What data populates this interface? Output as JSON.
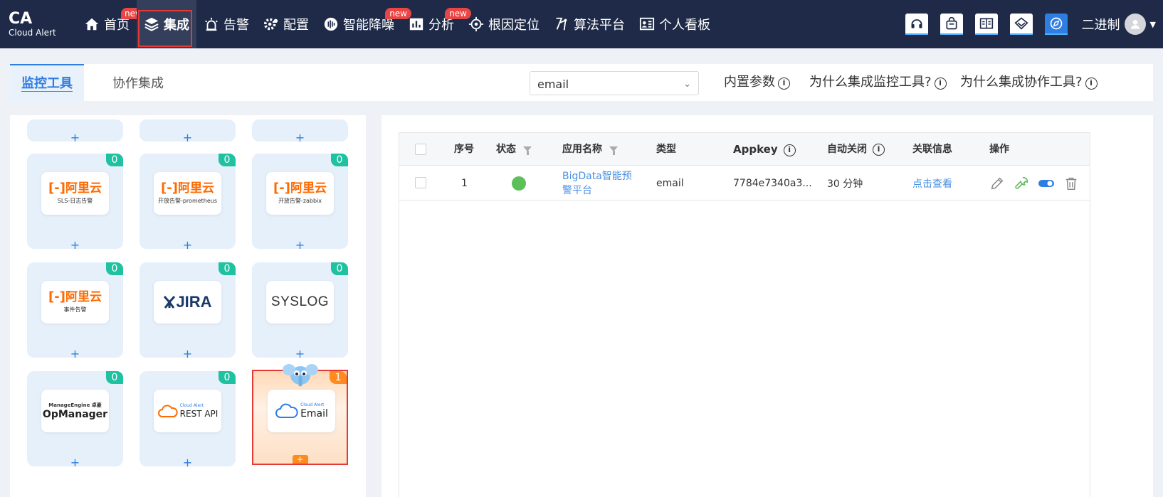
{
  "brand": {
    "name": "CA",
    "subtitle": "Cloud Alert"
  },
  "nav": {
    "items": [
      {
        "label": "首页",
        "icon": "home-icon",
        "badge": "new",
        "badge_style": "clipped"
      },
      {
        "label": "集成",
        "icon": "layers-icon",
        "active": true
      },
      {
        "label": "告警",
        "icon": "alarm-icon"
      },
      {
        "label": "配置",
        "icon": "gear-icon"
      },
      {
        "label": "智能降噪",
        "icon": "noise-reduction-icon",
        "badge": "new"
      },
      {
        "label": "分析",
        "icon": "bar-chart-icon",
        "badge": "new"
      },
      {
        "label": "根因定位",
        "icon": "target-icon"
      },
      {
        "label": "算法平台",
        "icon": "algorithm-icon"
      },
      {
        "label": "个人看板",
        "icon": "dashboard-icon"
      }
    ]
  },
  "toolbar_icons": [
    "headset-icon",
    "bag-icon",
    "book-icon",
    "diamond-icon",
    "compass-icon"
  ],
  "user": {
    "name": "二进制"
  },
  "tabs": [
    {
      "label": "监控工具",
      "active": true
    },
    {
      "label": "协作集成",
      "active": false
    }
  ],
  "search": {
    "value": "email"
  },
  "help_links": {
    "builtin_params": "内置参数",
    "why_monitor": "为什么集成监控工具?",
    "why_collab": "为什么集成协作工具?"
  },
  "integrations": [
    {
      "brand": "阿里云",
      "sub": "SLS-日志告警",
      "count": "0"
    },
    {
      "brand": "阿里云",
      "sub": "开放告警-prometheus",
      "count": "0"
    },
    {
      "brand": "阿里云",
      "sub": "开放告警-zabbix",
      "count": "0"
    },
    {
      "brand": "阿里云",
      "sub": "事件告警",
      "count": "0"
    },
    {
      "brand": "JIRA",
      "count": "0"
    },
    {
      "brand": "SYSLOG",
      "count": "0"
    },
    {
      "brand": "OpManager",
      "sub_top": "ManageEngine 卓豪",
      "count": "0"
    },
    {
      "brand": "REST API",
      "sub_top": "Cloud Alert",
      "count": "0"
    },
    {
      "brand": "Email",
      "sub_top": "Cloud Alert",
      "count": "1",
      "selected": true
    }
  ],
  "card_plus": "+",
  "table": {
    "headers": {
      "index": "序号",
      "status": "状态",
      "app_name": "应用名称",
      "type": "类型",
      "appkey": "Appkey",
      "auto_close": "自动关闭",
      "related": "关联信息",
      "actions": "操作"
    },
    "rows": [
      {
        "index": "1",
        "status": "green",
        "app_name": "BigData智能预警平台",
        "type": "email",
        "appkey": "7784e7340a3...",
        "auto_close": "30 分钟",
        "related": "点击查看",
        "actions": [
          "edit-icon",
          "wrench-icon",
          "toggle-icon",
          "trash-icon"
        ]
      }
    ]
  },
  "colors": {
    "nav_bg": "#1e2a48",
    "accent": "#2e7de1",
    "badge_new": "#e84545",
    "count_green": "#1fc2a0",
    "count_orange": "#ff8a1f",
    "status_green": "#5cbf5a",
    "aliyun_orange": "#ff6a00"
  }
}
